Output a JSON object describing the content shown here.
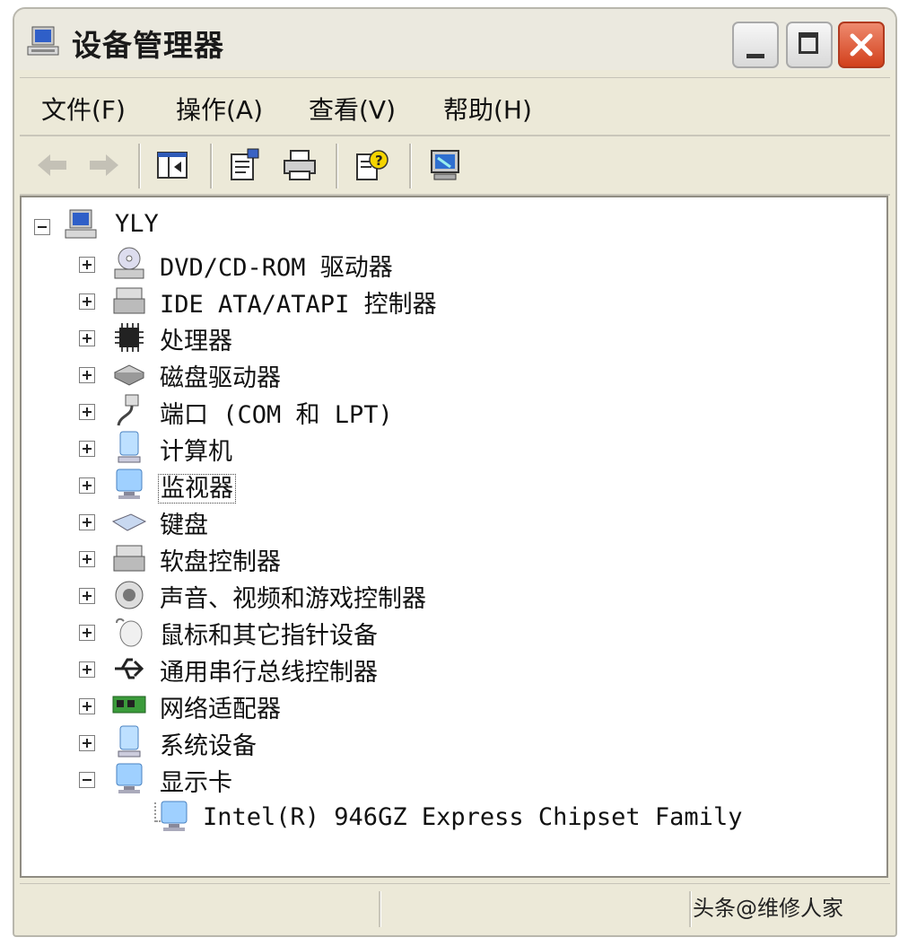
{
  "window": {
    "title": "设备管理器"
  },
  "menu": [
    {
      "label": "文件(F)"
    },
    {
      "label": "操作(A)"
    },
    {
      "label": "查看(V)"
    },
    {
      "label": "帮助(H)"
    }
  ],
  "toolbar": {
    "icons": [
      "back-arrow-icon",
      "forward-arrow-icon",
      "show-hide-tree-icon",
      "properties-icon",
      "print-icon",
      "help-icon",
      "scan-hardware-icon"
    ]
  },
  "tree": {
    "root": {
      "label": "YLY",
      "expanded": true
    },
    "categories": [
      {
        "label": "DVD/CD-ROM 驱动器",
        "expanded": false
      },
      {
        "label": "IDE ATA/ATAPI 控制器",
        "expanded": false
      },
      {
        "label": "处理器",
        "expanded": false
      },
      {
        "label": "磁盘驱动器",
        "expanded": false
      },
      {
        "label": "端口 (COM 和 LPT)",
        "expanded": false
      },
      {
        "label": "计算机",
        "expanded": false
      },
      {
        "label": "监视器",
        "expanded": false,
        "selected": true
      },
      {
        "label": "键盘",
        "expanded": false
      },
      {
        "label": "软盘控制器",
        "expanded": false
      },
      {
        "label": "声音、视频和游戏控制器",
        "expanded": false
      },
      {
        "label": "鼠标和其它指针设备",
        "expanded": false
      },
      {
        "label": "通用串行总线控制器",
        "expanded": false
      },
      {
        "label": "网络适配器",
        "expanded": false
      },
      {
        "label": "系统设备",
        "expanded": false
      },
      {
        "label": "显示卡",
        "expanded": true
      }
    ],
    "child": {
      "label": "Intel(R) 946GZ Express Chipset Family"
    }
  },
  "watermark": "头条@维修人家"
}
